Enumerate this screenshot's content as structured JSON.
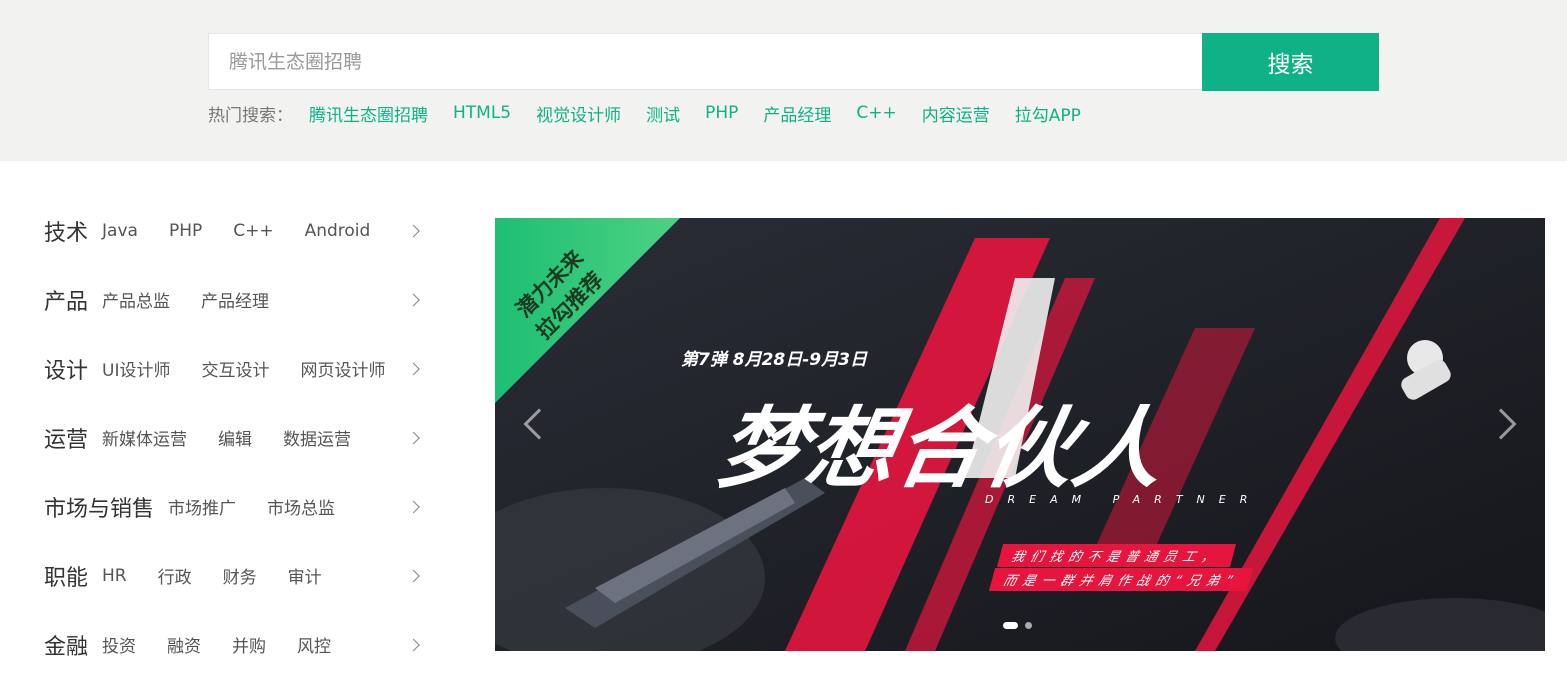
{
  "search": {
    "placeholder": "腾讯生态圈招聘",
    "button_label": "搜索",
    "hot_label": "热门搜索：",
    "hot_links": [
      "腾讯生态圈招聘",
      "HTML5",
      "视觉设计师",
      "测试",
      "PHP",
      "产品经理",
      "C++",
      "内容运营",
      "拉勾APP"
    ]
  },
  "categories": [
    {
      "title": "技术",
      "subs": [
        "Java",
        "PHP",
        "C++",
        "Android"
      ]
    },
    {
      "title": "产品",
      "subs": [
        "产品总监",
        "产品经理"
      ]
    },
    {
      "title": "设计",
      "subs": [
        "UI设计师",
        "交互设计",
        "网页设计师"
      ]
    },
    {
      "title": "运营",
      "subs": [
        "新媒体运营",
        "编辑",
        "数据运营"
      ]
    },
    {
      "title": "市场与销售",
      "subs": [
        "市场推广",
        "市场总监"
      ]
    },
    {
      "title": "职能",
      "subs": [
        "HR",
        "行政",
        "财务",
        "审计"
      ]
    },
    {
      "title": "金融",
      "subs": [
        "投资",
        "融资",
        "并购",
        "风控"
      ]
    }
  ],
  "banner": {
    "badge_line1": "潜力未来",
    "badge_line2": "拉勾推荐",
    "date": "第7弹 8月28日-9月3日",
    "title": "梦想合伙人",
    "subtitle_en": "DREAM PARTNER",
    "tagline1": "我们找的不是普通员工，",
    "tagline2": "而是一群并肩作战的“兄弟”",
    "slide_count": 2,
    "active_slide": 1
  },
  "colors": {
    "accent": "#0fb187",
    "banner_red": "#e5153e",
    "banner_bg": "#1c1e25",
    "search_bg": "#f2f3f1"
  }
}
